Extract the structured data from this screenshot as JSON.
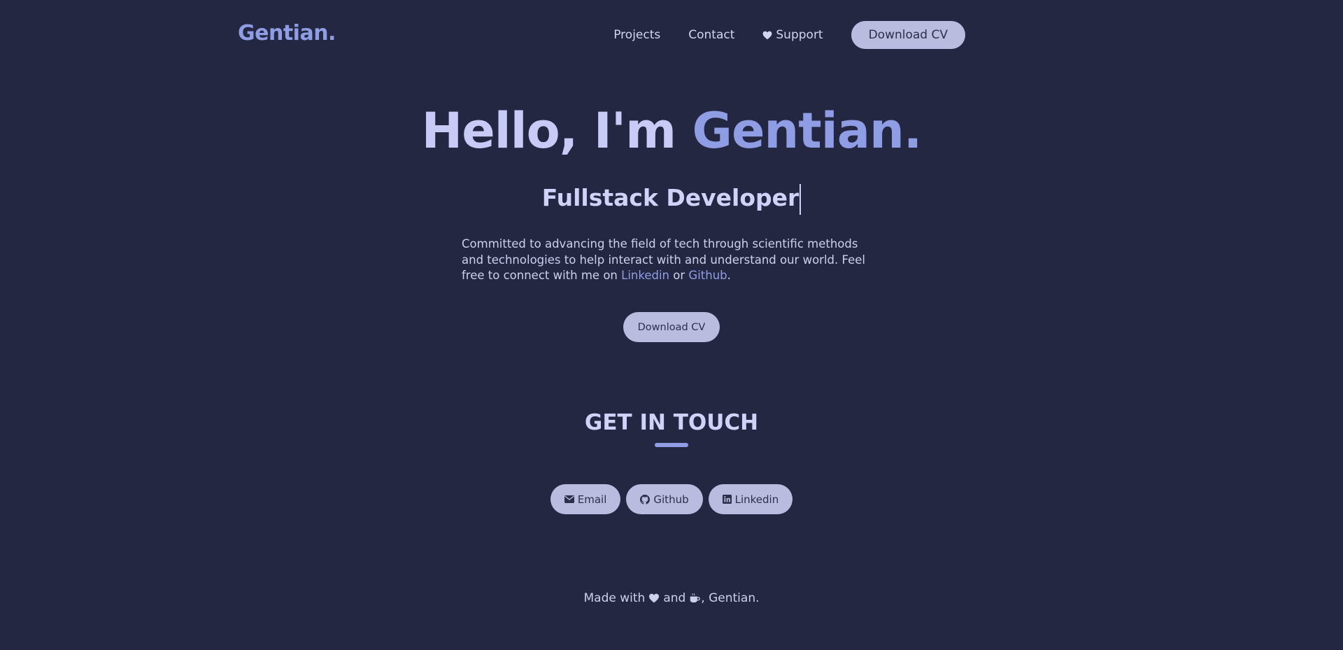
{
  "header": {
    "logo": "Gentian.",
    "nav": {
      "projects": "Projects",
      "contact": "Contact",
      "support": "Support"
    },
    "cv_button": "Download CV"
  },
  "hero": {
    "greeting": "Hello, I'm",
    "name": "Gentian.",
    "role": "Fullstack Developer",
    "intro_text": "Committed to advancing the field of tech through scientific methods and technologies to help interact with and understand our world. Feel free to connect with me on",
    "linkedin_link": "Linkedin",
    "or_text": "or",
    "github_link": "Github",
    "period": ".",
    "cv_button": "Download CV"
  },
  "contact": {
    "title": "GET IN TOUCH",
    "buttons": {
      "email": "Email",
      "github": "Github",
      "linkedin": "Linkedin"
    }
  },
  "footer": {
    "made_with": "Made with",
    "and": "and",
    "author": ", Gentian."
  },
  "icons": {
    "support": "heart-icon",
    "email": "envelope-icon",
    "github": "github-icon",
    "linkedin": "linkedin-icon",
    "footer_love": "heart-icon",
    "footer_coffee": "coffee-icon"
  },
  "colors": {
    "background": "#232741",
    "accent": "#8f9ee4",
    "button": "#b9bcdf",
    "text": "#cdd0ee"
  }
}
